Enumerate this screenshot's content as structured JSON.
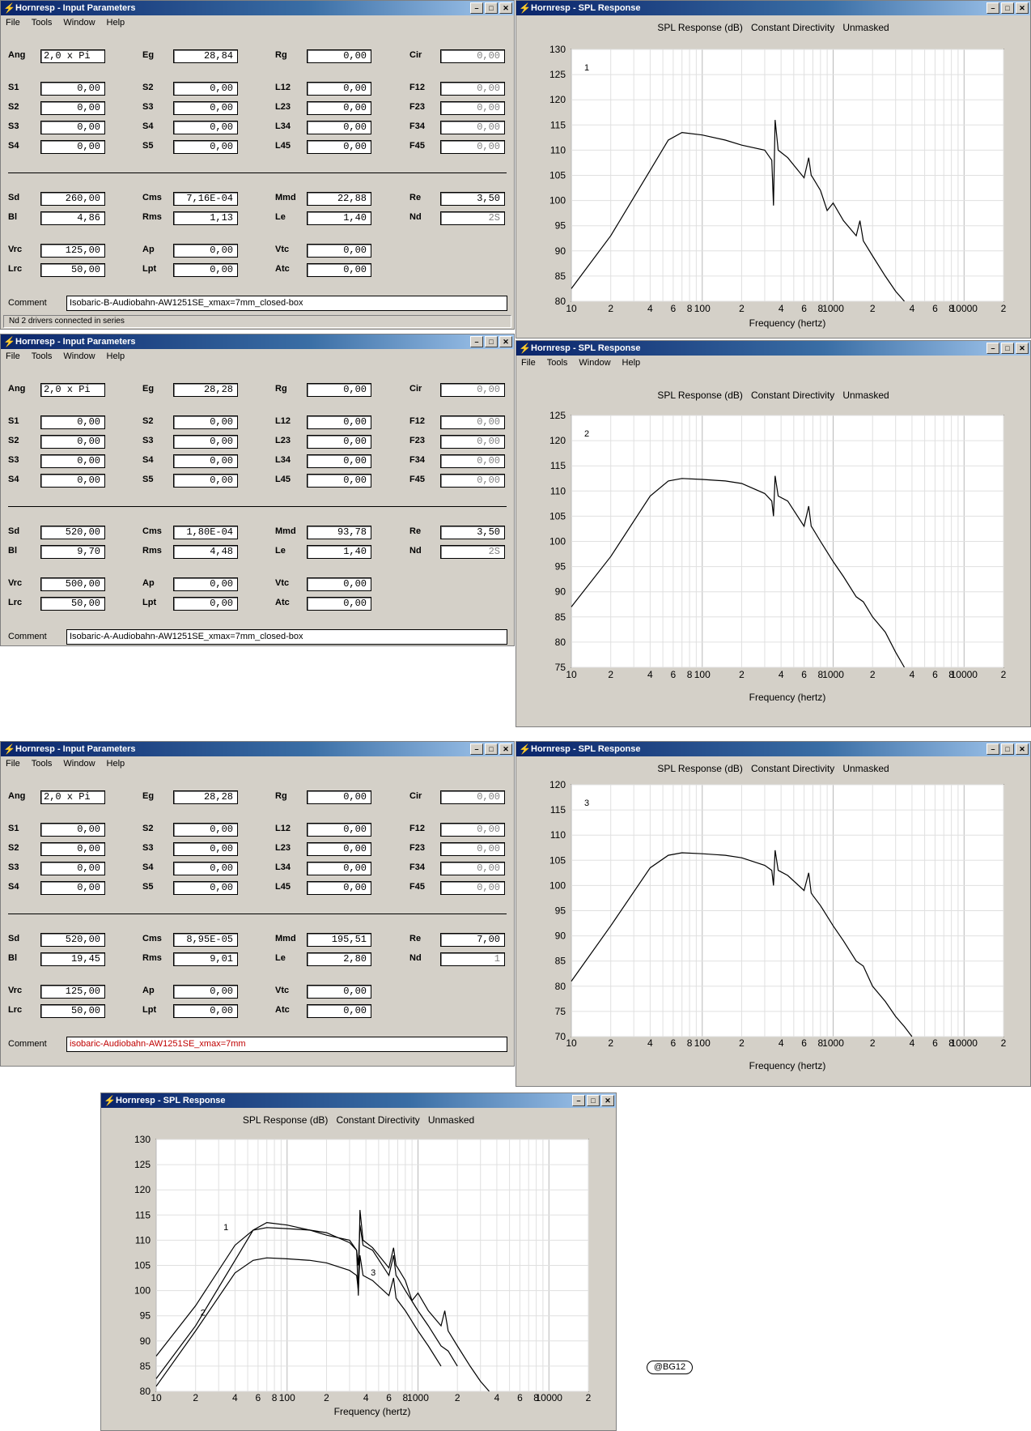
{
  "app": {
    "input_title": "Hornresp - Input Parameters",
    "spl_title": "Hornresp - SPL Response"
  },
  "menu": {
    "file": "File",
    "tools": "Tools",
    "window": "Window",
    "help": "Help"
  },
  "spl_header": {
    "spl": "SPL Response (dB)",
    "directivity": "Constant Directivity",
    "mask": "Unmasked"
  },
  "xlabel": "Frequency (hertz)",
  "xtick_labels": [
    "10",
    "2",
    "4",
    "6",
    "8",
    "100",
    "2",
    "4",
    "6",
    "8",
    "1000",
    "2",
    "4",
    "6",
    "8",
    "10000",
    "2"
  ],
  "labels": {
    "ang": "Ang",
    "eg": "Eg",
    "rg": "Rg",
    "cir": "Cir",
    "s1": "S1",
    "s2": "S2",
    "s3": "S3",
    "s4": "S4",
    "s5": "S5",
    "l12": "L12",
    "l23": "L23",
    "l34": "L34",
    "l45": "L45",
    "f12": "F12",
    "f23": "F23",
    "f34": "F34",
    "f45": "F45",
    "sd": "Sd",
    "cms": "Cms",
    "mmd": "Mmd",
    "re": "Re",
    "bl": "Bl",
    "rms": "Rms",
    "le": "Le",
    "nd": "Nd",
    "vrc": "Vrc",
    "ap": "Ap",
    "vtc": "Vtc",
    "lrc": "Lrc",
    "lpt": "Lpt",
    "atc": "Atc",
    "comment": "Comment"
  },
  "input_windows": [
    {
      "ang": "2,0 x Pi",
      "eg": "28,84",
      "rg": "0,00",
      "cir": "0,00",
      "s1": "0,00",
      "s2": "0,00",
      "s3": "0,00",
      "s4": "0,00",
      "s5": "0,00",
      "s2b": "0,00",
      "s3b": "0,00",
      "s4b": "0,00",
      "l12": "0,00",
      "l23": "0,00",
      "l34": "0,00",
      "l45": "0,00",
      "f12": "0,00",
      "f23": "0,00",
      "f34": "0,00",
      "f45": "0,00",
      "sd": "260,00",
      "cms": "7,16E-04",
      "mmd": "22,88",
      "re": "3,50",
      "bl": "4,86",
      "rms": "1,13",
      "le": "1,40",
      "nd": "2S",
      "vrc": "125,00",
      "ap": "0,00",
      "vtc": "0,00",
      "lrc": "50,00",
      "lpt": "0,00",
      "atc": "0,00",
      "comment": "Isobaric-B-Audiobahn-AW1251SE_xmax=7mm_closed-box",
      "status": "Nd   2 drivers connected in series"
    },
    {
      "ang": "2,0 x Pi",
      "eg": "28,28",
      "rg": "0,00",
      "cir": "0,00",
      "s1": "0,00",
      "s2": "0,00",
      "s3": "0,00",
      "s4": "0,00",
      "s5": "0,00",
      "s2b": "0,00",
      "s3b": "0,00",
      "s4b": "0,00",
      "l12": "0,00",
      "l23": "0,00",
      "l34": "0,00",
      "l45": "0,00",
      "f12": "0,00",
      "f23": "0,00",
      "f34": "0,00",
      "f45": "0,00",
      "sd": "520,00",
      "cms": "1,80E-04",
      "mmd": "93,78",
      "re": "3,50",
      "bl": "9,70",
      "rms": "4,48",
      "le": "1,40",
      "nd": "2S",
      "vrc": "500,00",
      "ap": "0,00",
      "vtc": "0,00",
      "lrc": "50,00",
      "lpt": "0,00",
      "atc": "0,00",
      "comment": "Isobaric-A-Audiobahn-AW1251SE_xmax=7mm_closed-box"
    },
    {
      "ang": "2,0 x Pi",
      "eg": "28,28",
      "rg": "0,00",
      "cir": "0,00",
      "s1": "0,00",
      "s2": "0,00",
      "s3": "0,00",
      "s4": "0,00",
      "s5": "0,00",
      "s2b": "0,00",
      "s3b": "0,00",
      "s4b": "0,00",
      "l12": "0,00",
      "l23": "0,00",
      "l34": "0,00",
      "l45": "0,00",
      "f12": "0,00",
      "f23": "0,00",
      "f34": "0,00",
      "f45": "0,00",
      "sd": "520,00",
      "cms": "8,95E-05",
      "mmd": "195,51",
      "re": "7,00",
      "bl": "19,45",
      "rms": "9,01",
      "le": "2,80",
      "nd": "1",
      "vrc": "125,00",
      "ap": "0,00",
      "vtc": "0,00",
      "lrc": "50,00",
      "lpt": "0,00",
      "atc": "0,00",
      "comment": "isobaric-Audiobahn-AW1251SE_xmax=7mm",
      "comment_color": "#c00000"
    }
  ],
  "watermark": "@BG12",
  "chart_data": [
    {
      "type": "line",
      "title": "SPL Response (dB)  Constant Directivity  Unmasked",
      "xlabel": "Frequency (hertz)",
      "x_scale": "log",
      "xlim": [
        10,
        20000
      ],
      "ylim": [
        80,
        130
      ],
      "yticks": [
        80,
        85,
        90,
        95,
        100,
        105,
        110,
        115,
        120,
        125,
        130
      ],
      "series": [
        {
          "name": "1",
          "x": [
            10,
            20,
            40,
            55,
            70,
            100,
            150,
            200,
            300,
            340,
            350,
            360,
            380,
            450,
            600,
            650,
            680,
            700,
            800,
            900,
            1000,
            1200,
            1500,
            1600,
            1700,
            2000,
            2500,
            3000,
            3500
          ],
          "y": [
            82.5,
            93,
            106,
            112,
            113.5,
            113,
            112,
            111,
            110,
            108,
            99,
            116,
            110,
            108.5,
            104.5,
            108.5,
            105,
            104.5,
            102,
            98,
            99.5,
            96,
            93,
            96,
            92,
            89,
            85,
            82,
            80
          ]
        }
      ]
    },
    {
      "type": "line",
      "title": "SPL Response (dB)  Constant Directivity  Unmasked",
      "xlabel": "Frequency (hertz)",
      "x_scale": "log",
      "xlim": [
        10,
        20000
      ],
      "ylim": [
        75,
        125
      ],
      "yticks": [
        75,
        80,
        85,
        90,
        95,
        100,
        105,
        110,
        115,
        120,
        125
      ],
      "series": [
        {
          "name": "2",
          "x": [
            10,
            20,
            40,
            55,
            70,
            100,
            150,
            200,
            300,
            340,
            350,
            360,
            380,
            450,
            600,
            650,
            680,
            700,
            800,
            1000,
            1200,
            1500,
            1700,
            2000,
            2500,
            3000,
            3500
          ],
          "y": [
            87,
            97,
            109,
            112,
            112.5,
            112.3,
            112,
            111.5,
            109.5,
            108,
            105,
            113,
            109,
            108,
            103,
            107,
            103,
            102.5,
            100,
            96,
            93,
            89,
            88,
            85,
            82,
            78,
            75
          ]
        }
      ]
    },
    {
      "type": "line",
      "title": "SPL Response (dB)  Constant Directivity  Unmasked",
      "xlabel": "Frequency (hertz)",
      "x_scale": "log",
      "xlim": [
        10,
        20000
      ],
      "ylim": [
        70,
        120
      ],
      "yticks": [
        70,
        75,
        80,
        85,
        90,
        95,
        100,
        105,
        110,
        115,
        120
      ],
      "series": [
        {
          "name": "3",
          "x": [
            10,
            20,
            40,
            55,
            70,
            100,
            150,
            200,
            300,
            340,
            350,
            360,
            380,
            450,
            600,
            650,
            680,
            700,
            800,
            1000,
            1200,
            1500,
            1700,
            2000,
            2500,
            3000,
            3500,
            4000
          ],
          "y": [
            81,
            92,
            103.5,
            106,
            106.5,
            106.3,
            106,
            105.5,
            104,
            103,
            100,
            107,
            103,
            102,
            99,
            102.5,
            98.5,
            98,
            96,
            92,
            89,
            85,
            84,
            80,
            77,
            74,
            72,
            70
          ]
        }
      ]
    },
    {
      "type": "line",
      "title": "SPL Response (dB)  Constant Directivity  Unmasked",
      "xlabel": "Frequency (hertz)",
      "x_scale": "log",
      "xlim": [
        10,
        20000
      ],
      "ylim": [
        80,
        130
      ],
      "yticks": [
        80,
        85,
        90,
        95,
        100,
        105,
        110,
        115,
        120,
        125,
        130
      ],
      "series": [
        {
          "name": "1",
          "x": [
            10,
            20,
            40,
            55,
            70,
            100,
            150,
            200,
            300,
            340,
            350,
            360,
            380,
            450,
            600,
            650,
            680,
            700,
            800,
            900,
            1000,
            1200,
            1500,
            1600,
            1700,
            2000,
            2500,
            3000,
            3500
          ],
          "y": [
            82.5,
            93,
            106,
            112,
            113.5,
            113,
            112,
            111,
            110,
            108,
            99,
            116,
            110,
            108.5,
            104.5,
            108.5,
            105,
            104.5,
            102,
            98,
            99.5,
            96,
            93,
            96,
            92,
            89,
            85,
            82,
            80
          ]
        },
        {
          "name": "2",
          "x": [
            10,
            20,
            40,
            55,
            70,
            100,
            150,
            200,
            300,
            340,
            350,
            360,
            380,
            450,
            600,
            650,
            680,
            700,
            800,
            1000,
            1200,
            1500,
            1700,
            2000
          ],
          "y": [
            87,
            97,
            109,
            112,
            112.5,
            112.3,
            112,
            111.5,
            109.5,
            108,
            105,
            113,
            109,
            108,
            103,
            107,
            103,
            102.5,
            100,
            96,
            93,
            89,
            88,
            85
          ]
        },
        {
          "name": "3",
          "x": [
            10,
            20,
            40,
            55,
            70,
            100,
            150,
            200,
            300,
            340,
            350,
            360,
            380,
            450,
            600,
            650,
            680,
            700,
            800,
            1000,
            1200,
            1500
          ],
          "y": [
            81,
            92,
            103.5,
            106,
            106.5,
            106.3,
            106,
            105.5,
            104,
            103,
            100,
            107,
            103,
            102,
            99,
            102.5,
            98.5,
            98,
            96,
            92,
            89,
            85
          ]
        }
      ]
    }
  ]
}
